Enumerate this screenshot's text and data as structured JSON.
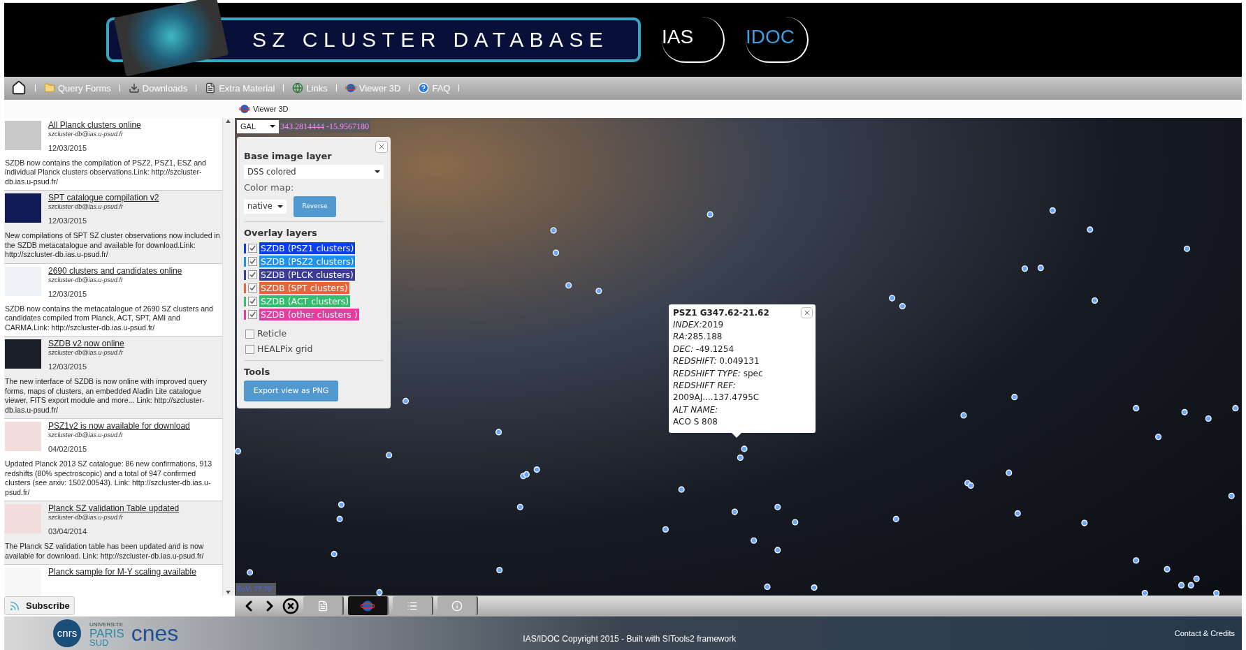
{
  "header": {
    "banner_title": "SZ CLUSTER DATABASE",
    "logos": [
      "IAS",
      "IDOC"
    ]
  },
  "nav": {
    "items": [
      {
        "label": "Query Forms"
      },
      {
        "label": "Downloads"
      },
      {
        "label": "Extra Material"
      },
      {
        "label": "Links"
      },
      {
        "label": "Viewer 3D"
      },
      {
        "label": "FAQ"
      }
    ]
  },
  "breadcrumb": "Viewer 3D",
  "news": [
    {
      "title": "All Planck clusters online",
      "email": "szcluster-db@ias.u-psud.fr",
      "date": "12/03/2015",
      "body": "SZDB now contains the compilation of PSZ2, PSZ1, ESZ and individual Planck clusters observations.Link: http://szcluster-db.ias.u-psud.fr/"
    },
    {
      "title": "SPT catalogue compilation v2",
      "email": "szcluster-db@ias.u-psud.fr",
      "date": "12/03/2015",
      "body": "New compilations of SPT SZ cluster observations now included in the SZDB metacatalogue and available for download.Link: http://szcluster-db.ias.u-psud.fr/"
    },
    {
      "title": "2690 clusters and candidates online",
      "email": "szcluster-db@ias.u-psud.fr",
      "date": "12/03/2015",
      "body": "SZDB now contains the metacatalogue of 2690 SZ clusters and candidates compiled from Planck, ACT, SPT, AMI and CARMA.Link: http://szcluster-db.ias.u-psud.fr/"
    },
    {
      "title": "SZDB v2 now online",
      "email": "szcluster-db@ias.u-psud.fr",
      "date": "12/03/2015",
      "body": "The new interface of SZDB is now online with improved query forms, maps of clusters, an embedded Aladin Lite catalogue viewer, FITS export module and more... Link: http://szcluster-db.ias.u-psud.fr/"
    },
    {
      "title": "PSZ1v2 is now available for download",
      "email": "szcluster-db@ias.u-psud.fr",
      "date": "04/02/2015",
      "body": "Updated Planck 2013 SZ catalogue: 86 new confirmations, 913 redshifts (80% spectroscopic) and a total of 947 confirmed clusters (see arxiv: 1502.00543). Link: http://szcluster-db.ias.u-psud.fr/"
    },
    {
      "title": "Planck SZ validation Table updated",
      "email": "szcluster-db@ias.u-psud.fr",
      "date": "03/04/2014",
      "body": "The Planck SZ validation table has been updated and is now available for download. Link: http://szcluster-db.ias.u-psud.fr/"
    },
    {
      "title": "Planck sample for M-Y scaling available"
    }
  ],
  "subscribe": "Subscribe",
  "viewer": {
    "frame": "GAL",
    "coords": "343.2814444 -15.9567180",
    "fov": "FoV: 77.76°",
    "panel": {
      "base_heading": "Base image layer",
      "base_layer": "DSS colored",
      "colormap_label": "Color map:",
      "colormap": "native",
      "reverse": "Reverse",
      "overlay_heading": "Overlay layers",
      "overlays": [
        {
          "label": "SZDB (PSZ1 clusters)",
          "color": "#0a3cf0",
          "checked": true
        },
        {
          "label": "SZDB (PSZ2 clusters)",
          "color": "#1e90f0",
          "checked": true
        },
        {
          "label": "SZDB (PLCK clusters)",
          "color": "#3c3c96",
          "checked": true
        },
        {
          "label": "SZDB (SPT clusters)",
          "color": "#e6643c",
          "checked": true
        },
        {
          "label": "SZDB (ACT clusters)",
          "color": "#32be6e",
          "checked": true
        },
        {
          "label": "SZDB (other clusters )",
          "color": "#e63ca0",
          "checked": true
        }
      ],
      "options": [
        {
          "label": "Reticle",
          "checked": false
        },
        {
          "label": "HEALPix grid",
          "checked": false
        }
      ],
      "tools_heading": "Tools",
      "export": "Export view as PNG"
    },
    "popup": {
      "title": "PSZ1 G347.62-21.62",
      "fields": [
        {
          "key": "INDEX:",
          "value": "2019"
        },
        {
          "key": "RA:",
          "value": "285.188"
        },
        {
          "key": "DEC:",
          "value": " -49.1254"
        },
        {
          "key": "REDSHIFT:",
          "value": " 0.049131"
        },
        {
          "key": "REDSHIFT TYPE:",
          "value": " spec"
        },
        {
          "key": "REDSHIFT REF:"
        },
        {
          "value": "2009AJ....137.4795C"
        },
        {
          "key": "ALT NAME:"
        },
        {
          "value": "ACO S 808"
        }
      ]
    },
    "toolbar": [
      {
        "selected": false
      },
      {
        "selected": true
      },
      {
        "selected": false
      },
      {
        "selected": false
      }
    ]
  },
  "footer": {
    "logos": [
      "cnrs",
      "UNIVERSITE",
      "PARIS",
      "SUD",
      "cnes"
    ],
    "copyright": "IAS/IDOC Copyright 2015 - Built with SITools2 framework",
    "contact": "Contact & Credits"
  }
}
